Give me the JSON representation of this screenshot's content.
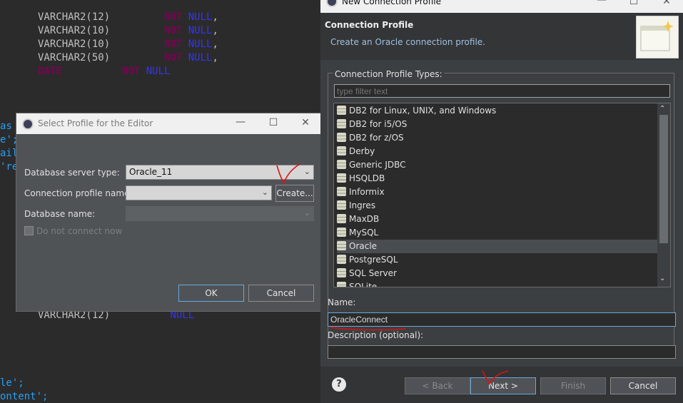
{
  "editor": {
    "lines": [
      {
        "type": "VARCHAR2(12)",
        "kw": "NOT",
        "null": "NULL",
        "punc": ","
      },
      {
        "type": "VARCHAR2(10)",
        "kw": "NOT",
        "null": "NULL",
        "punc": ","
      },
      {
        "type": "VARCHAR2(10)",
        "kw": "NOT",
        "null": "NULL",
        "punc": ","
      },
      {
        "type": "VARCHAR2(50)",
        "kw": "NOT",
        "null": "NULL",
        "punc": ","
      }
    ],
    "date_line": {
      "type": "DATE",
      "kw": "NOT",
      "null": "NULL"
    },
    "left_fragments": [
      "as",
      "e';",
      "ail",
      "'re"
    ],
    "varchar_line": {
      "type": "VARCHAR2(12)",
      "null": "NULL"
    },
    "bottom_fragments": [
      "le';",
      "ontent';"
    ]
  },
  "select_dialog": {
    "title": "Select Profile for the Editor",
    "server_type_label": "Database server type:",
    "server_type_value": "Oracle_11",
    "conn_profile_label": "Connection profile name:",
    "conn_profile_value": "",
    "create_button": "Create...",
    "db_name_label": "Database name:",
    "db_name_value": "",
    "do_not_connect_label": "Do not connect now",
    "ok_button": "OK",
    "cancel_button": "Cancel"
  },
  "wizard": {
    "title": "New Connection Profile",
    "banner_heading": "Connection Profile",
    "banner_desc": "Create an Oracle connection profile.",
    "group_label": "Connection Profile Types:",
    "filter_placeholder": "type filter text",
    "profile_types": [
      "DB2 for Linux, UNIX, and Windows",
      "DB2 for i5/OS",
      "DB2 for z/OS",
      "Derby",
      "Generic JDBC",
      "HSQLDB",
      "Informix",
      "Ingres",
      "MaxDB",
      "MySQL",
      "Oracle",
      "PostgreSQL",
      "SQL Server",
      "SQLite"
    ],
    "selected_type": "Oracle",
    "name_label": "Name:",
    "name_value": "OracleConnect",
    "desc_label": "Description (optional):",
    "desc_value": "",
    "help_glyph": "?",
    "back_button": "< Back",
    "next_button": "Next >",
    "finish_button": "Finish",
    "cancel_button": "Cancel"
  },
  "colors": {
    "accent_border": "#6aa9dd",
    "annotation_red": "#e01010",
    "keyword": "#7f0055",
    "null_kw": "#3333ff"
  }
}
